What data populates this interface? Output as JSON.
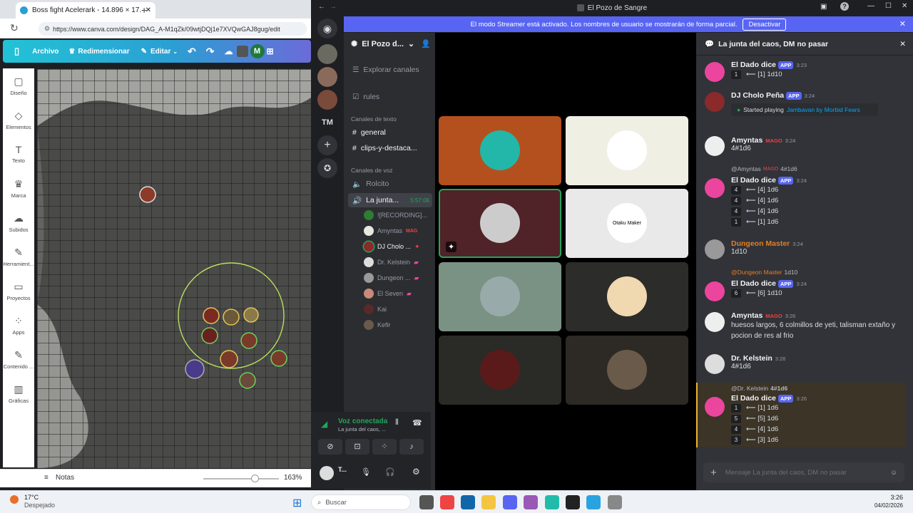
{
  "browser": {
    "tab_title": "Boss fight Acelerark - 14.896 × 17...",
    "url": "https://www.canva.com/design/DAG_A-M1qZk/09wtjDQj1e7XVQwGAJ8gug/edit"
  },
  "canva": {
    "menu": {
      "file": "Archivo",
      "resize": "Redimensionar",
      "edit": "Editar",
      "avatar_letter": "M"
    },
    "sidebar": [
      {
        "label": "Diseño",
        "icon": "layout-icon"
      },
      {
        "label": "Elementos",
        "icon": "elements-icon"
      },
      {
        "label": "Texto",
        "icon": "text-icon"
      },
      {
        "label": "Marca",
        "icon": "brand-icon"
      },
      {
        "label": "Subidos",
        "icon": "upload-icon"
      },
      {
        "label": "Herramient...",
        "icon": "tools-icon"
      },
      {
        "label": "Proyectos",
        "icon": "folder-icon"
      },
      {
        "label": "Apps",
        "icon": "apps-icon"
      },
      {
        "label": "Contenido ...",
        "icon": "content-icon"
      },
      {
        "label": "Gráficas",
        "icon": "chart-icon"
      }
    ],
    "notes": "Notas",
    "zoom": "163%"
  },
  "discord": {
    "window_title": "El Pozo de Sangre",
    "streamer_banner": "El modo Streamer está activado. Los nombres de usuario se mostrarán de forma parcial.",
    "streamer_button": "Desactivar",
    "server_badge": "TM",
    "server_name": "El Pozo d...",
    "browse_channels": "Explorar canales",
    "rules": "rules",
    "text_category": "Canales de texto",
    "text_channels": [
      "general",
      "clips-y-destaca..."
    ],
    "voice_category": "Canales de voz",
    "voice_channels": [
      "Rolcito"
    ],
    "active_voice": {
      "name": "La junta...",
      "timer": "5:57:06"
    },
    "voice_users": [
      "![RECORDING]...",
      "Amyntas",
      "DJ Cholo ...",
      "Dr. Kelstein",
      "Dungeon ...",
      "El Seven",
      "Kai",
      "Kefir"
    ],
    "mago_tag": "MAG",
    "voice_panel": {
      "status": "Voz conectada",
      "channel": "La junta del caos, ...",
      "user": "T..."
    },
    "chat": {
      "title": "La junta del caos, DM no pasar",
      "input_placeholder": "Mensaje La junta del caos, DM no pasar",
      "messages": [
        {
          "author": "El Dado dice",
          "badge": "APP",
          "time": "3:23",
          "dice": [
            {
              "n": "1",
              "r": "⟵ [1] 1d10"
            }
          ]
        },
        {
          "author": "DJ Cholo Peña",
          "badge": "APP",
          "time": "3:24",
          "activity": "Started playing",
          "activity_link": "Jambavan by Morbid Fears"
        },
        {
          "author": "Amyntas",
          "badge": "MAGO",
          "time": "3:24",
          "text": "4#1d6"
        },
        {
          "reply": "@Amyntas",
          "reply_badge": "MAGO",
          "reply_text": "4#1d6",
          "author": "El Dado dice",
          "badge": "APP",
          "time": "3:24",
          "dice": [
            {
              "n": "4",
              "r": "⟵ [4] 1d6"
            },
            {
              "n": "4",
              "r": "⟵ [4] 1d6"
            },
            {
              "n": "4",
              "r": "⟵ [4] 1d6"
            },
            {
              "n": "1",
              "r": "⟵ [1] 1d6"
            }
          ]
        },
        {
          "author": "Dungeon Master",
          "time": "3:24",
          "text": "1d10"
        },
        {
          "reply": "@Dungeon Master",
          "reply_text": "1d10",
          "author": "El Dado dice",
          "badge": "APP",
          "time": "3:24",
          "dice": [
            {
              "n": "6",
              "r": "⟵ [6] 1d10"
            }
          ]
        },
        {
          "author": "Amyntas",
          "badge": "MAGO",
          "time": "3:26",
          "text": "huesos largos, 6 colmillos de yeti, talisman extaño y pocion de res al frio"
        },
        {
          "author": "Dr. Kelstein",
          "time": "3:26",
          "text": "4#1d6"
        },
        {
          "reply": "@Dr. Kelstein",
          "reply_text": "4#1d6",
          "author": "El Dado dice",
          "badge": "APP",
          "time": "3:26",
          "dice": [
            {
              "n": "1",
              "r": "⟵ [1] 1d6"
            },
            {
              "n": "5",
              "r": "⟵ [5] 1d6"
            },
            {
              "n": "4",
              "r": "⟵ [4] 1d6"
            },
            {
              "n": "3",
              "r": "⟵ [3] 1d6"
            }
          ]
        }
      ]
    },
    "grid_tiles": [
      {
        "bg": "#b4501e"
      },
      {
        "bg": "#efefe4"
      },
      {
        "bg": "#4f2327",
        "speaking": true
      },
      {
        "bg": "#e9e9e9"
      },
      {
        "bg": "#7a9283"
      },
      {
        "bg": "#2c2c2a"
      },
      {
        "bg": "#2a2a27"
      },
      {
        "bg": "#2d2a26"
      }
    ],
    "tile_text": "Otaku Maker"
  },
  "taskbar": {
    "weather_temp": "17°C",
    "weather_desc": "Despejado",
    "search": "Buscar",
    "time": "3:26",
    "date": "04/02/2026"
  },
  "colors": {
    "accent": "#5865f2",
    "dm_name": "#e67e22",
    "voice_green": "#23a55a",
    "canva_grad": "#22c3d6"
  }
}
